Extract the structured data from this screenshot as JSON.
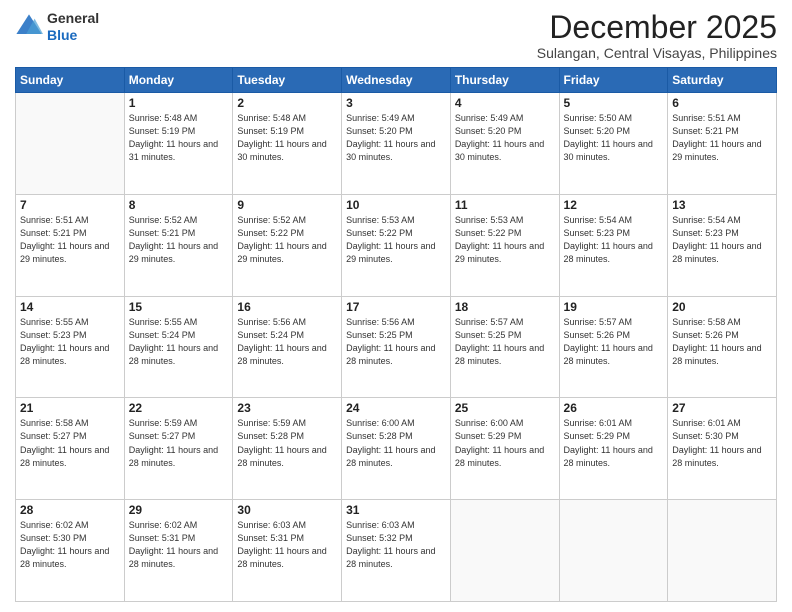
{
  "logo": {
    "general": "General",
    "blue": "Blue"
  },
  "header": {
    "month": "December 2025",
    "location": "Sulangan, Central Visayas, Philippines"
  },
  "weekdays": [
    "Sunday",
    "Monday",
    "Tuesday",
    "Wednesday",
    "Thursday",
    "Friday",
    "Saturday"
  ],
  "weeks": [
    [
      {
        "day": "",
        "info": ""
      },
      {
        "day": "1",
        "info": "Sunrise: 5:48 AM\nSunset: 5:19 PM\nDaylight: 11 hours\nand 31 minutes."
      },
      {
        "day": "2",
        "info": "Sunrise: 5:48 AM\nSunset: 5:19 PM\nDaylight: 11 hours\nand 30 minutes."
      },
      {
        "day": "3",
        "info": "Sunrise: 5:49 AM\nSunset: 5:20 PM\nDaylight: 11 hours\nand 30 minutes."
      },
      {
        "day": "4",
        "info": "Sunrise: 5:49 AM\nSunset: 5:20 PM\nDaylight: 11 hours\nand 30 minutes."
      },
      {
        "day": "5",
        "info": "Sunrise: 5:50 AM\nSunset: 5:20 PM\nDaylight: 11 hours\nand 30 minutes."
      },
      {
        "day": "6",
        "info": "Sunrise: 5:51 AM\nSunset: 5:21 PM\nDaylight: 11 hours\nand 29 minutes."
      }
    ],
    [
      {
        "day": "7",
        "info": "Sunrise: 5:51 AM\nSunset: 5:21 PM\nDaylight: 11 hours\nand 29 minutes."
      },
      {
        "day": "8",
        "info": "Sunrise: 5:52 AM\nSunset: 5:21 PM\nDaylight: 11 hours\nand 29 minutes."
      },
      {
        "day": "9",
        "info": "Sunrise: 5:52 AM\nSunset: 5:22 PM\nDaylight: 11 hours\nand 29 minutes."
      },
      {
        "day": "10",
        "info": "Sunrise: 5:53 AM\nSunset: 5:22 PM\nDaylight: 11 hours\nand 29 minutes."
      },
      {
        "day": "11",
        "info": "Sunrise: 5:53 AM\nSunset: 5:22 PM\nDaylight: 11 hours\nand 29 minutes."
      },
      {
        "day": "12",
        "info": "Sunrise: 5:54 AM\nSunset: 5:23 PM\nDaylight: 11 hours\nand 28 minutes."
      },
      {
        "day": "13",
        "info": "Sunrise: 5:54 AM\nSunset: 5:23 PM\nDaylight: 11 hours\nand 28 minutes."
      }
    ],
    [
      {
        "day": "14",
        "info": "Sunrise: 5:55 AM\nSunset: 5:23 PM\nDaylight: 11 hours\nand 28 minutes."
      },
      {
        "day": "15",
        "info": "Sunrise: 5:55 AM\nSunset: 5:24 PM\nDaylight: 11 hours\nand 28 minutes."
      },
      {
        "day": "16",
        "info": "Sunrise: 5:56 AM\nSunset: 5:24 PM\nDaylight: 11 hours\nand 28 minutes."
      },
      {
        "day": "17",
        "info": "Sunrise: 5:56 AM\nSunset: 5:25 PM\nDaylight: 11 hours\nand 28 minutes."
      },
      {
        "day": "18",
        "info": "Sunrise: 5:57 AM\nSunset: 5:25 PM\nDaylight: 11 hours\nand 28 minutes."
      },
      {
        "day": "19",
        "info": "Sunrise: 5:57 AM\nSunset: 5:26 PM\nDaylight: 11 hours\nand 28 minutes."
      },
      {
        "day": "20",
        "info": "Sunrise: 5:58 AM\nSunset: 5:26 PM\nDaylight: 11 hours\nand 28 minutes."
      }
    ],
    [
      {
        "day": "21",
        "info": "Sunrise: 5:58 AM\nSunset: 5:27 PM\nDaylight: 11 hours\nand 28 minutes."
      },
      {
        "day": "22",
        "info": "Sunrise: 5:59 AM\nSunset: 5:27 PM\nDaylight: 11 hours\nand 28 minutes."
      },
      {
        "day": "23",
        "info": "Sunrise: 5:59 AM\nSunset: 5:28 PM\nDaylight: 11 hours\nand 28 minutes."
      },
      {
        "day": "24",
        "info": "Sunrise: 6:00 AM\nSunset: 5:28 PM\nDaylight: 11 hours\nand 28 minutes."
      },
      {
        "day": "25",
        "info": "Sunrise: 6:00 AM\nSunset: 5:29 PM\nDaylight: 11 hours\nand 28 minutes."
      },
      {
        "day": "26",
        "info": "Sunrise: 6:01 AM\nSunset: 5:29 PM\nDaylight: 11 hours\nand 28 minutes."
      },
      {
        "day": "27",
        "info": "Sunrise: 6:01 AM\nSunset: 5:30 PM\nDaylight: 11 hours\nand 28 minutes."
      }
    ],
    [
      {
        "day": "28",
        "info": "Sunrise: 6:02 AM\nSunset: 5:30 PM\nDaylight: 11 hours\nand 28 minutes."
      },
      {
        "day": "29",
        "info": "Sunrise: 6:02 AM\nSunset: 5:31 PM\nDaylight: 11 hours\nand 28 minutes."
      },
      {
        "day": "30",
        "info": "Sunrise: 6:03 AM\nSunset: 5:31 PM\nDaylight: 11 hours\nand 28 minutes."
      },
      {
        "day": "31",
        "info": "Sunrise: 6:03 AM\nSunset: 5:32 PM\nDaylight: 11 hours\nand 28 minutes."
      },
      {
        "day": "",
        "info": ""
      },
      {
        "day": "",
        "info": ""
      },
      {
        "day": "",
        "info": ""
      }
    ]
  ]
}
